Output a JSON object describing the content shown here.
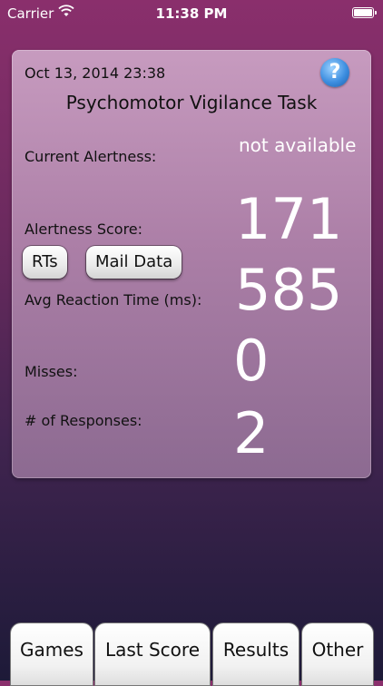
{
  "status_bar": {
    "carrier": "Carrier",
    "time": "11:38 PM"
  },
  "panel": {
    "date": "Oct 13, 2014 23:38",
    "title": "Psychomotor Vigilance Task",
    "help_icon": "?",
    "current_alertness_label": "Current Alertness:",
    "current_alertness_value": "not available",
    "alertness_score_label": "Alertness Score:",
    "alertness_score_value": "171",
    "avg_reaction_label": "Avg Reaction Time (ms):",
    "avg_reaction_value": "585",
    "misses_label": "Misses:",
    "misses_value": "0",
    "responses_label": "# of Responses:",
    "responses_value": "2",
    "buttons": {
      "rts": "RTs",
      "mail_data": "Mail Data"
    }
  },
  "tabs": [
    "Games",
    "Last Score",
    "Results",
    "Other"
  ],
  "colors": {
    "background_top": "#8a2f6c",
    "background_bottom": "#1d1a38",
    "panel": "#b48aae",
    "help_icon": "#3d8ee0"
  }
}
